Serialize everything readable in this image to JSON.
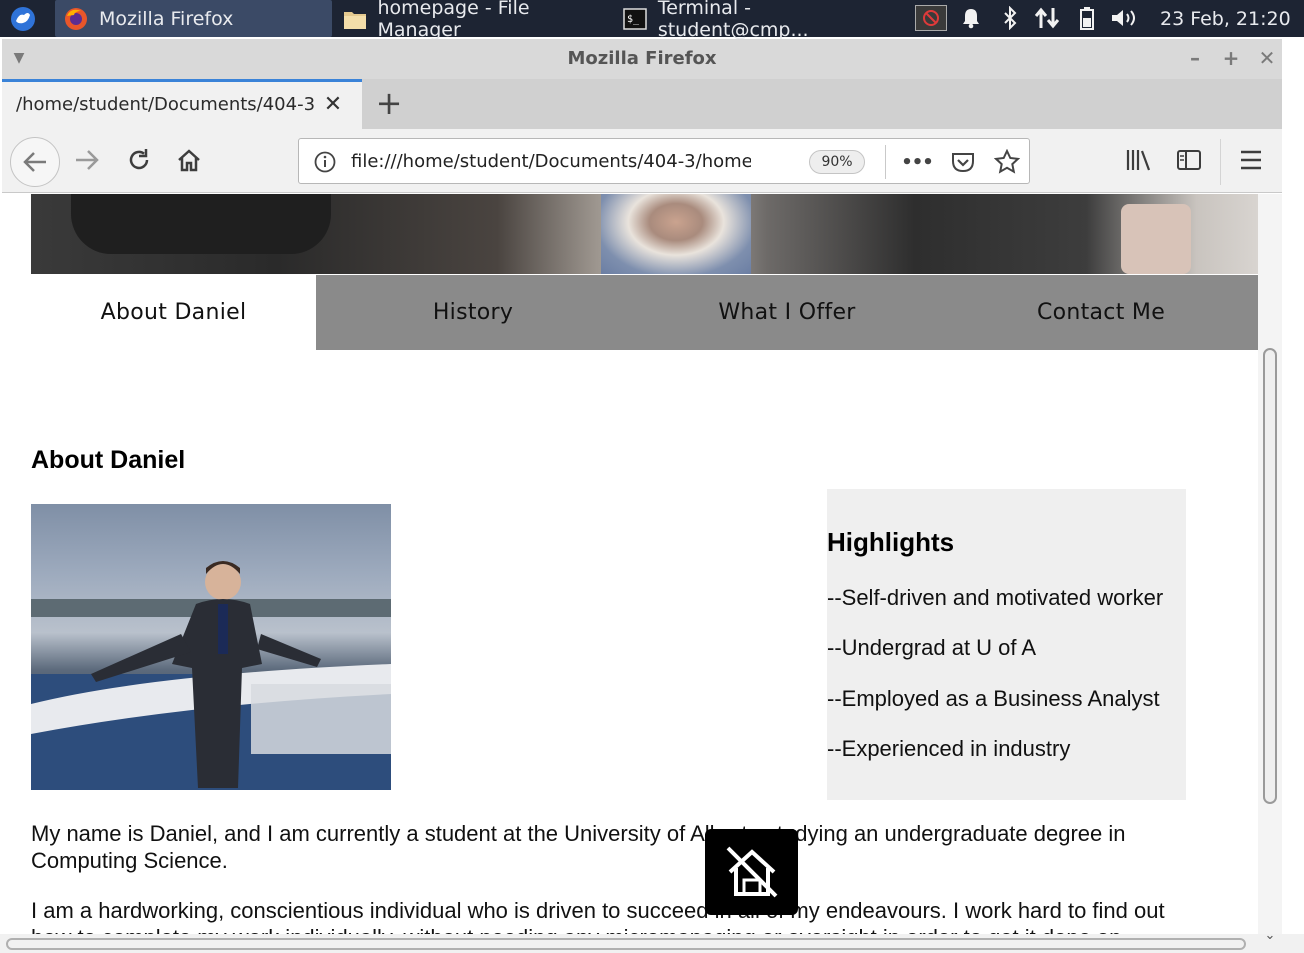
{
  "taskbar": {
    "tasks": [
      {
        "label": "Mozilla Firefox",
        "icon": "firefox-icon",
        "active": true
      },
      {
        "label": "homepage - File Manager",
        "icon": "folder-icon",
        "active": false
      },
      {
        "label": "Terminal - student@cmp...",
        "icon": "terminal-icon",
        "active": false
      }
    ],
    "clock": "23 Feb, 21:20",
    "tray_icons": [
      "no-entry-icon",
      "bell-icon",
      "bluetooth-icon",
      "network-transfer-icon",
      "battery-icon",
      "volume-icon"
    ]
  },
  "window": {
    "title": "Mozilla Firefox",
    "controls": {
      "minimize": "–",
      "maximize": "+",
      "close": "✕"
    }
  },
  "browser": {
    "tab_title": "/home/student/Documents/404-3",
    "url": "file:///home/student/Documents/404-3/home",
    "zoom": "90%",
    "page_actions_glyph": "•••"
  },
  "page": {
    "nav_tabs": [
      "About Daniel",
      "History",
      "What I Offer",
      "Contact Me"
    ],
    "active_tab": "About Daniel",
    "heading": "About Daniel",
    "highlights": {
      "title": "Highlights",
      "items": [
        "--Self-driven and motivated worker",
        "--Undergrad at U of A",
        "--Employed as a Business Analyst",
        "--Experienced in industry"
      ]
    },
    "paragraphs": [
      "My name is Daniel, and I am currently a student at the University of Alberta studying an undergraduate degree in Computing Science.",
      "I am a hardworking, conscientious individual who is driven to succeed in all of my endeavours. I work hard to find out how to complete my work individually, without needing any micromanaging or oversight in order to get it done on"
    ]
  },
  "colors": {
    "taskbar_bg": "#1d2433",
    "nav_tab_bar": "#8a8a8a",
    "highlights_bg": "#efefef",
    "tab_accent": "#3a83d8"
  }
}
